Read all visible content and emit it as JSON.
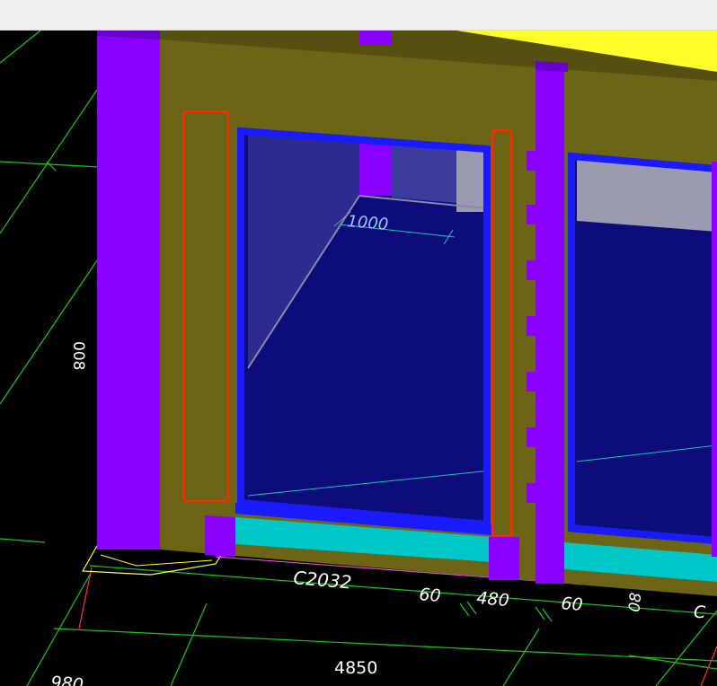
{
  "colors": {
    "background": "#000000",
    "wall": "#6b6515",
    "column": "#8a00ff",
    "glass": "#0c0c7a",
    "window_frame": "#1a1aff",
    "sill": "#00c8c8",
    "highlight": "#ff2a00",
    "grid": "#00c800",
    "yellow": "#ffff2a"
  },
  "labels": {
    "room_depth": "1000",
    "window_tag": "C2032",
    "dim_60_left": "60",
    "dim_480": "480",
    "dim_60_right": "60",
    "dim_total": "4850",
    "dim_980": "980",
    "dim_vertical": "008",
    "dim_small_a": "08",
    "dim_small_c": "C"
  }
}
